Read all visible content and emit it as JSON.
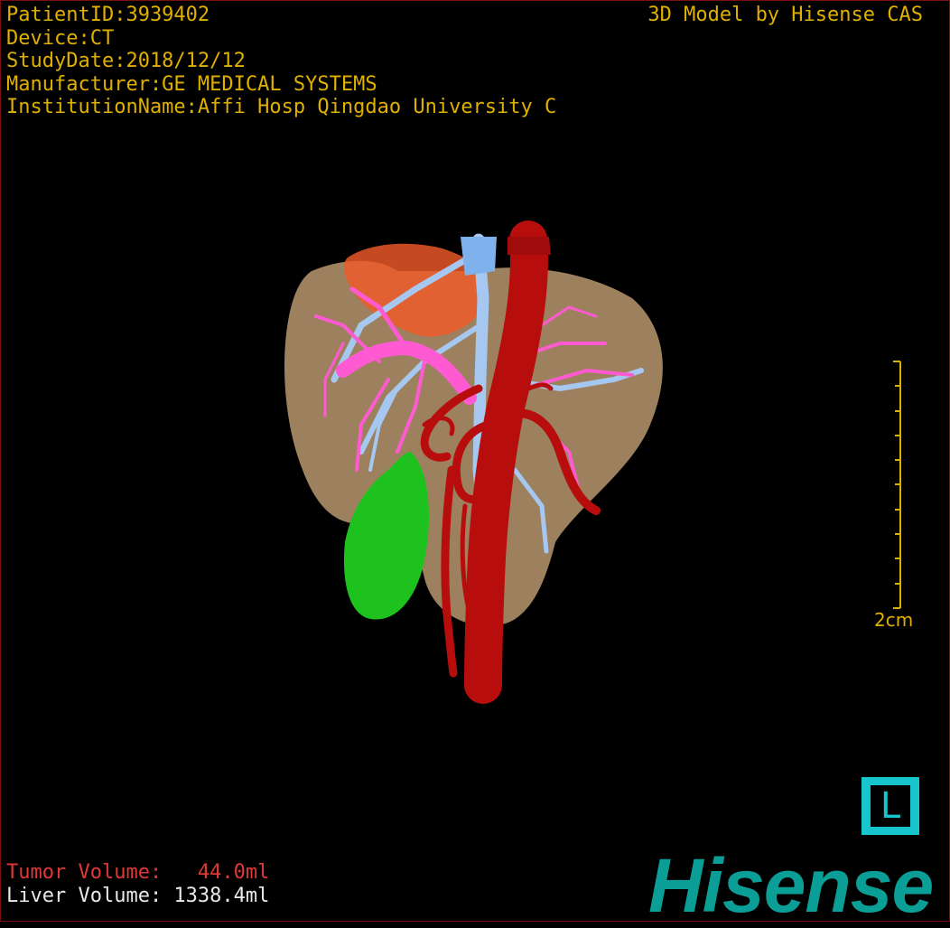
{
  "patient_info": {
    "patient_id": "PatientID:3939402",
    "device": "Device:CT",
    "study_date": "StudyDate:2018/12/12",
    "manufacturer": "Manufacturer:GE MEDICAL SYSTEMS",
    "institution": "InstitutionName:Affi Hosp Qingdao University C"
  },
  "brand_line": "3D Model by Hisense CAS",
  "scale_bar": {
    "label": "2cm"
  },
  "orientation_marker": {
    "label": "L"
  },
  "volumes": {
    "tumor": "Tumor Volume:   44.0ml",
    "liver": "Liver Volume: 1338.4ml"
  },
  "logo": "Hisense",
  "colors": {
    "overlay_text": "#e0b000",
    "tumor_text": "#e03838",
    "liver_text": "#e8e8e8",
    "brand_teal": "#0a9e96",
    "orientation_cube": "#16c6cc",
    "liver": "#c9a57a",
    "aorta": "#b80d0d",
    "portal_vein": "#ff5ad2",
    "hepatic_vein": "#a6c8f0",
    "gallbladder": "#1ec21e",
    "tumor": "#f05a28"
  }
}
